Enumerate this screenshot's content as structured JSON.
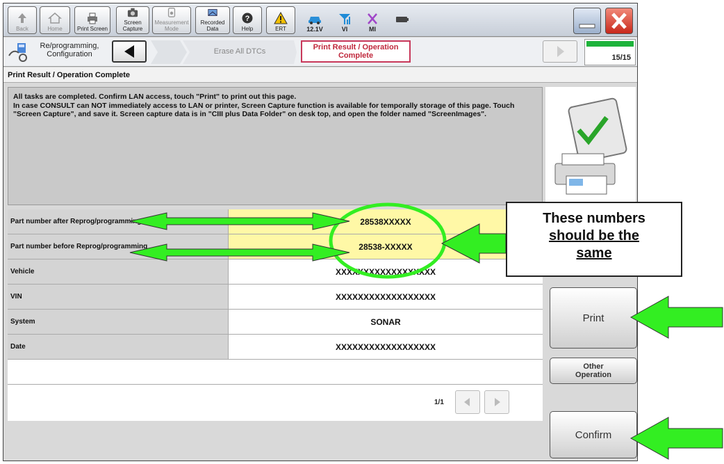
{
  "toolbar": {
    "back": "Back",
    "home": "Home",
    "print_screen": "Print Screen",
    "screen_capture": "Screen Capture",
    "measurement_mode": "Measurement Mode",
    "recorded_data": "Recorded Data",
    "help": "Help",
    "ert": "ERT",
    "voltage": "12.1V",
    "vi": "VI",
    "mi": "MI"
  },
  "nav": {
    "breadcrumb_main": "Re/programming, Configuration",
    "step_prev": "Erase All DTCs",
    "step_current": "Print Result / Operation Complete",
    "progress_text": "15/15",
    "progress_fraction": 1.0
  },
  "page_title": "Print Result / Operation Complete",
  "message": "All tasks are completed. Confirm LAN access, touch \"Print\" to print out this page.\nIn case CONSULT can NOT immediately access to LAN or printer, Screen Capture function is available for temporally storage of this page. Touch \"Screen Capture\", and save it. Screen capture data is in \"CIII plus Data Folder\" on desk top, and open the folder named \"ScreenImages\".",
  "table": [
    {
      "label": "Part number after Reprog/programming",
      "value": "28538XXXXX"
    },
    {
      "label": "Part number before Reprog/programming",
      "value": "28538-XXXXX"
    },
    {
      "label": "Vehicle",
      "value": "XXXXXXXXXXXXXXXXXX"
    },
    {
      "label": "VIN",
      "value": "XXXXXXXXXXXXXXXXXX"
    },
    {
      "label": "System",
      "value": "SONAR"
    },
    {
      "label": "Date",
      "value": "XXXXXXXXXXXXXXXXXX"
    }
  ],
  "pager": "1/1",
  "buttons": {
    "print": "Print",
    "other_line1": "Other",
    "other_line2": "Operation",
    "confirm": "Confirm"
  },
  "callout": {
    "line1": "These numbers",
    "line2": "should be the",
    "line3": "same"
  },
  "colors": {
    "highlight": "#fff8a6",
    "arrow_green": "#33ee22",
    "current_step_border": "#c8385a",
    "progress": "#1db33b"
  }
}
